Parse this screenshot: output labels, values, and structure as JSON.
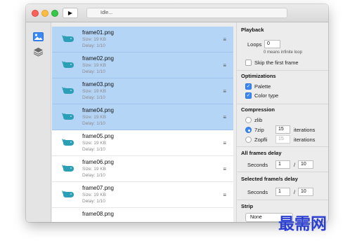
{
  "toolbar": {
    "play_icon": "play-icon",
    "status_text": "Idle..."
  },
  "sidebar": {
    "items": [
      {
        "icon": "image-icon",
        "selected": true
      },
      {
        "icon": "layers-icon",
        "selected": false
      }
    ]
  },
  "frames": [
    {
      "name": "frame01.png",
      "size": "Size: 19 KB",
      "delay": "Delay: 1/10",
      "selected": true
    },
    {
      "name": "frame02.png",
      "size": "Size: 19 KB",
      "delay": "Delay: 1/10",
      "selected": true
    },
    {
      "name": "frame03.png",
      "size": "Size: 19 KB",
      "delay": "Delay: 1/10",
      "selected": true
    },
    {
      "name": "frame04.png",
      "size": "Size: 19 KB",
      "delay": "Delay: 1/10",
      "selected": true
    },
    {
      "name": "frame05.png",
      "size": "Size: 19 KB",
      "delay": "Delay: 1/10",
      "selected": false
    },
    {
      "name": "frame06.png",
      "size": "Size: 19 KB",
      "delay": "Delay: 1/10",
      "selected": false
    },
    {
      "name": "frame07.png",
      "size": "Size: 19 KB",
      "delay": "Delay: 1/10",
      "selected": false
    },
    {
      "name": "frame08.png",
      "size": "",
      "delay": "",
      "selected": false
    }
  ],
  "panel": {
    "playback": {
      "title": "Playback",
      "loops_label": "Loops",
      "loops_value": "0",
      "loops_hint": "0 means infinite loop",
      "skip_first_label": "Skip the first frame",
      "skip_first_checked": false
    },
    "optimizations": {
      "title": "Optimizations",
      "palette_label": "Palette",
      "palette_checked": true,
      "color_type_label": "Color type",
      "color_type_checked": true
    },
    "compression": {
      "title": "Compression",
      "zlib_label": "zlib",
      "sevenzip_label": "7zip",
      "sevenzip_iterations": "15",
      "zopfli_label": "Zopfli",
      "zopfli_iterations": "15",
      "iterations_label": "iterations",
      "selected": "7zip"
    },
    "all_frames_delay": {
      "title": "All frames delay",
      "seconds_label": "Seconds",
      "numerator": "1",
      "slash": "/",
      "denominator": "10"
    },
    "selected_frames_delay": {
      "title": "Selected frame/s delay",
      "seconds_label": "Seconds",
      "numerator": "1",
      "slash": "/",
      "denominator": "10"
    },
    "strip": {
      "title": "Strip",
      "selected_value": "None"
    }
  },
  "watermark": {
    "text": "最需网"
  },
  "colors": {
    "selection": "#b5d5f6",
    "accent": "#3b88f5",
    "thumb": "#2a9fb5"
  }
}
